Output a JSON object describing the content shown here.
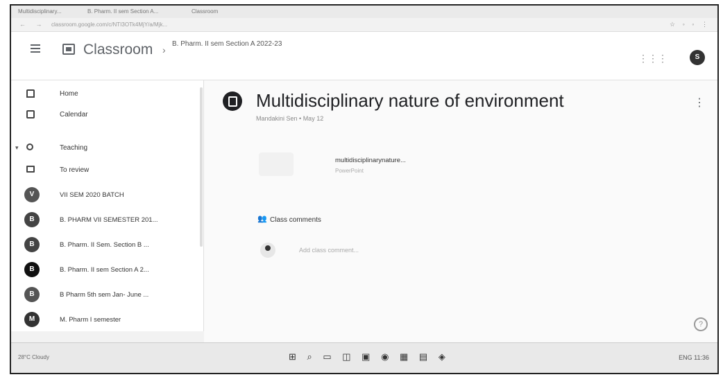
{
  "browser": {
    "tabs": [
      "Multidisciplinary...",
      "B. Pharm. II sem Section A...",
      "Classroom"
    ],
    "url": "classroom.google.com/c/NTI3OTk4MjY/a/Mjk..."
  },
  "header": {
    "app_title": "Classroom",
    "breadcrumb": "B. Pharm. II sem Section A 2022-23",
    "avatar_letter": "S"
  },
  "sidebar": {
    "items": [
      {
        "label": "Home",
        "icon": "home-icon"
      },
      {
        "label": "Calendar",
        "icon": "calendar-icon"
      },
      {
        "label": "Teaching",
        "icon": "people-icon"
      },
      {
        "label": "To review",
        "icon": "folder-icon"
      }
    ],
    "classes": [
      {
        "letter": "V",
        "label": "VII SEM 2020 BATCH"
      },
      {
        "letter": "B",
        "label": "B. PHARM VII SEMESTER 201..."
      },
      {
        "letter": "B",
        "label": "B. Pharm. II Sem. Section B ..."
      },
      {
        "letter": "B",
        "label": "B. Pharm. II sem Section A 2..."
      },
      {
        "letter": "B",
        "label": "B Pharm 5th sem Jan- June ..."
      },
      {
        "letter": "M",
        "label": "M. Pharm I semester"
      }
    ]
  },
  "post": {
    "title": "Multidisciplinary nature of environment",
    "meta": "Mandakini Sen • May 12",
    "attachment_title": "multidisciplinarynature...",
    "attachment_type": "PowerPoint",
    "comments_label": "Class comments",
    "comment_placeholder": "Add class comment..."
  },
  "taskbar": {
    "left": "28°C Cloudy",
    "right": "ENG 11:36"
  }
}
